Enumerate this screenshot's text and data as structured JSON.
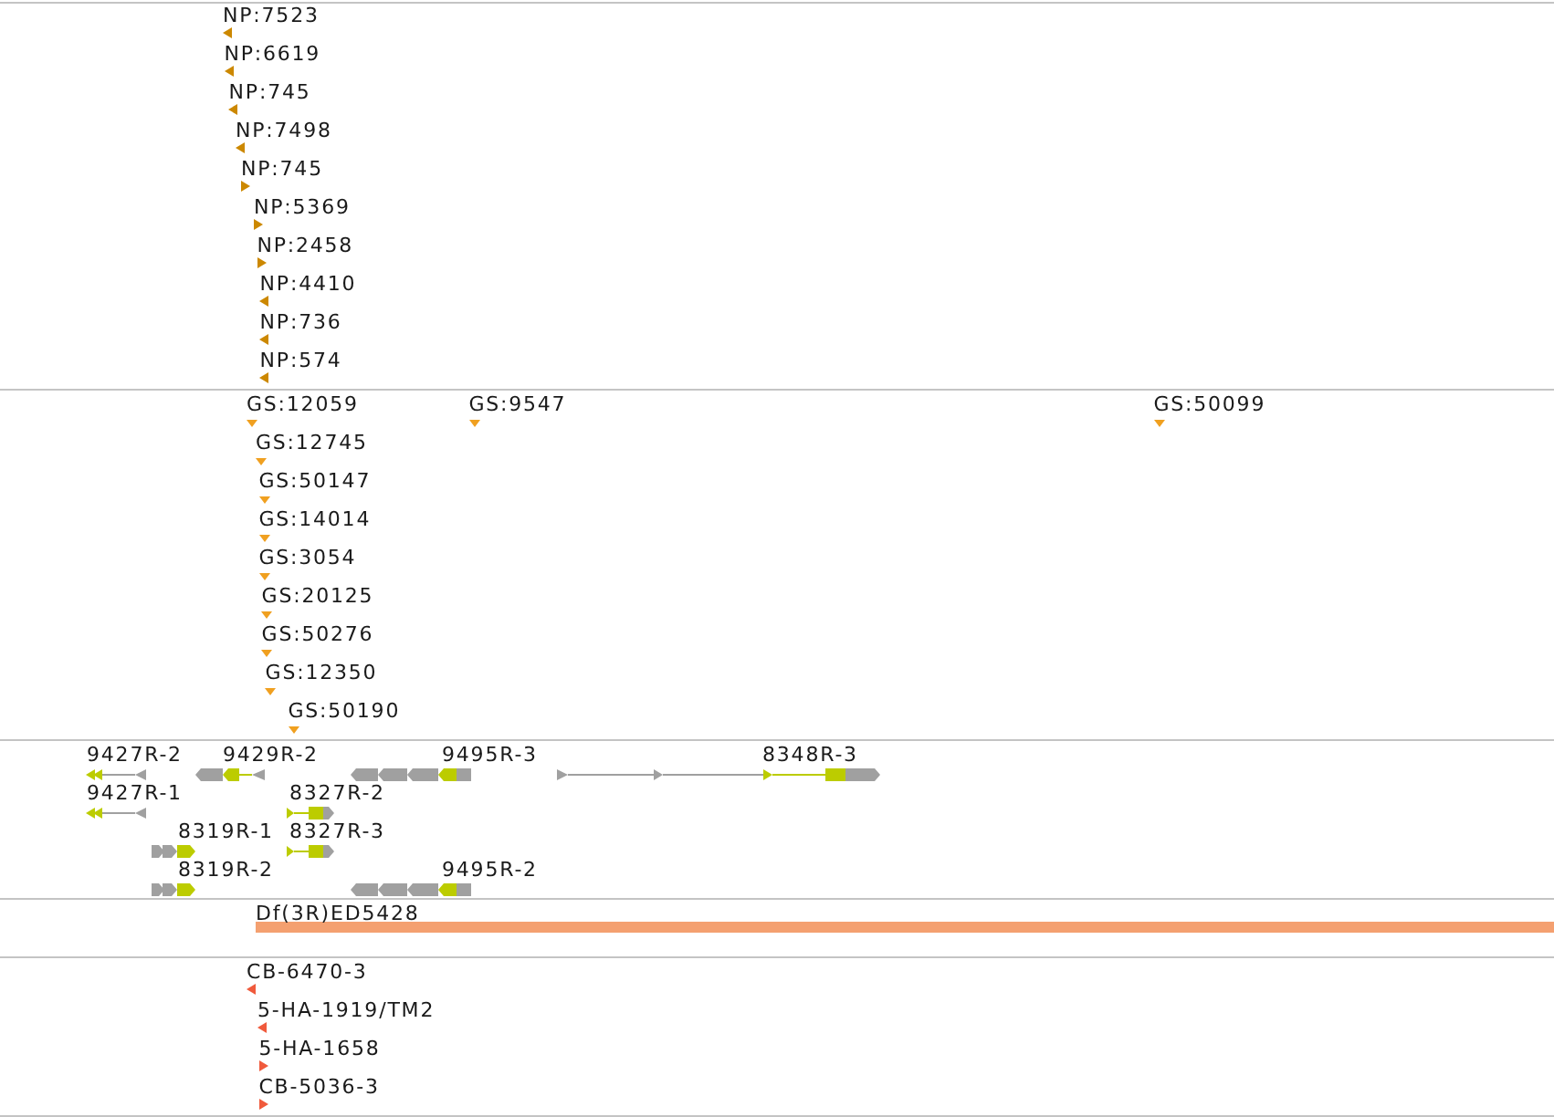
{
  "tracks": [
    {
      "kind": "insertions",
      "color": "#cc8800",
      "items": [
        {
          "label": "NP:7523",
          "reverse": true
        },
        {
          "label": "NP:6619",
          "reverse": true
        },
        {
          "label": "NP:745",
          "reverse": true
        },
        {
          "label": "NP:7498",
          "reverse": true
        },
        {
          "label": "NP:745",
          "reverse": false
        },
        {
          "label": "NP:5369",
          "reverse": false
        },
        {
          "label": "NP:2458",
          "reverse": false
        },
        {
          "label": "NP:4410",
          "reverse": true
        },
        {
          "label": "NP:736",
          "reverse": true
        },
        {
          "label": "NP:574",
          "reverse": true
        }
      ]
    },
    {
      "kind": "sites",
      "color": "#f0a020",
      "items": [
        {
          "label": "GS:12059"
        },
        {
          "label": "GS:9547"
        },
        {
          "label": "GS:50099"
        },
        {
          "label": "GS:12745"
        },
        {
          "label": "GS:50147"
        },
        {
          "label": "GS:14014"
        },
        {
          "label": "GS:3054"
        },
        {
          "label": "GS:20125"
        },
        {
          "label": "GS:50276"
        },
        {
          "label": "GS:12350"
        },
        {
          "label": "GS:50190"
        }
      ]
    },
    {
      "kind": "genes",
      "items": [
        {
          "label": "9427R-2",
          "reverse": true
        },
        {
          "label": "9429R-2",
          "reverse": true
        },
        {
          "label": "9495R-3",
          "reverse": true
        },
        {
          "label": "8348R-3",
          "reverse": false
        },
        {
          "label": "9427R-1",
          "reverse": true
        },
        {
          "label": "8327R-2",
          "reverse": false
        },
        {
          "label": "8319R-1",
          "reverse": false
        },
        {
          "label": "8327R-3",
          "reverse": false
        },
        {
          "label": "8319R-2",
          "reverse": false
        },
        {
          "label": "9495R-2",
          "reverse": true
        }
      ]
    },
    {
      "kind": "deficiencies",
      "color": "#f4a070",
      "items": [
        {
          "label": "Df(3R)ED5428"
        }
      ]
    },
    {
      "kind": "insertions",
      "color": "#f05a3c",
      "items": [
        {
          "label": "CB-6470-3",
          "reverse": true
        },
        {
          "label": "5-HA-1919/TM2",
          "reverse": true
        },
        {
          "label": "5-HA-1658",
          "reverse": false
        },
        {
          "label": "CB-5036-3",
          "reverse": false
        }
      ]
    }
  ]
}
